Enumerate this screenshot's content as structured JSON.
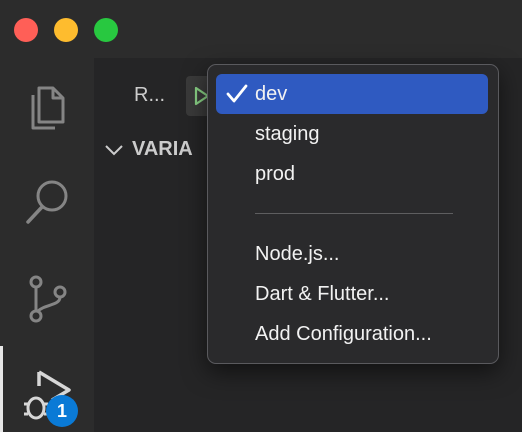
{
  "window": {
    "traffic_lights": {
      "close": "#ff5f57",
      "minimize": "#febc2e",
      "zoom": "#28c840"
    }
  },
  "activity_bar": {
    "items": [
      {
        "name": "explorer",
        "icon": "files-icon"
      },
      {
        "name": "search",
        "icon": "search-icon"
      },
      {
        "name": "source-control",
        "icon": "source-control-icon"
      },
      {
        "name": "run-and-debug",
        "icon": "debug-icon",
        "active": true
      }
    ],
    "debug_badge": "1"
  },
  "sidebar": {
    "run_label": "R...",
    "section_title": "VARIA"
  },
  "dropdown": {
    "options": [
      {
        "label": "dev",
        "selected": true
      },
      {
        "label": "staging",
        "selected": false
      },
      {
        "label": "prod",
        "selected": false
      }
    ],
    "separator": true,
    "actions": [
      {
        "label": "Node.js..."
      },
      {
        "label": "Dart & Flutter..."
      },
      {
        "label": "Add Configuration..."
      }
    ]
  },
  "colors": {
    "selection": "#2f5ac1",
    "badge": "#0a7ad6",
    "run_icon": "#89d185"
  }
}
